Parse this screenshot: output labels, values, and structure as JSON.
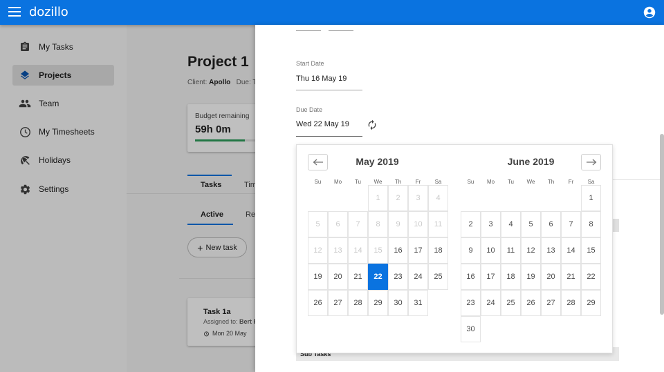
{
  "app": {
    "logo": "dozillo"
  },
  "sidebar": {
    "items": [
      {
        "label": "My Tasks",
        "icon": "clipboard-icon"
      },
      {
        "label": "Projects",
        "icon": "layers-icon",
        "active": true
      },
      {
        "label": "Team",
        "icon": "people-icon"
      },
      {
        "label": "My Timesheets",
        "icon": "clock-icon"
      },
      {
        "label": "Holidays",
        "icon": "beach-umbrella-icon"
      },
      {
        "label": "Settings",
        "icon": "gear-icon"
      }
    ]
  },
  "project": {
    "title": "Project 1",
    "client_prefix": "Client:",
    "client_name": "Apollo",
    "due_prefix": "Due: T",
    "budget_label": "Budget remaining",
    "budget_value": "59h  0m",
    "budget_progress": 0.65,
    "tabs": [
      "Tasks",
      "Tim"
    ],
    "subtabs": [
      "Active",
      "Rev"
    ],
    "new_task_label": "New task",
    "task": {
      "title": "Task 1a",
      "assigned_prefix": "Assigned to:",
      "assigned_name": "Bert P",
      "date": "Mon 20 May"
    }
  },
  "form": {
    "start_date_label": "Start Date",
    "start_date_value": "Thu 16 May 19",
    "due_date_label": "Due Date",
    "due_date_value": "Wed 22 May 19",
    "subtasks_label": "Sub Tasks"
  },
  "calendar": {
    "weekdays": [
      "Su",
      "Mo",
      "Tu",
      "We",
      "Th",
      "Fr",
      "Sa"
    ],
    "months": [
      {
        "title": "May 2019",
        "first_weekday": 3,
        "days": 31,
        "disabled_through": 15,
        "selected": 22
      },
      {
        "title": "June 2019",
        "first_weekday": 6,
        "days": 30,
        "disabled_through": 0,
        "selected": null
      }
    ],
    "prev_icon": "arrow-left-icon",
    "next_icon": "arrow-right-icon"
  },
  "colors": {
    "brand": "#0a73e0",
    "budget_bar": "#2e9e5b"
  }
}
